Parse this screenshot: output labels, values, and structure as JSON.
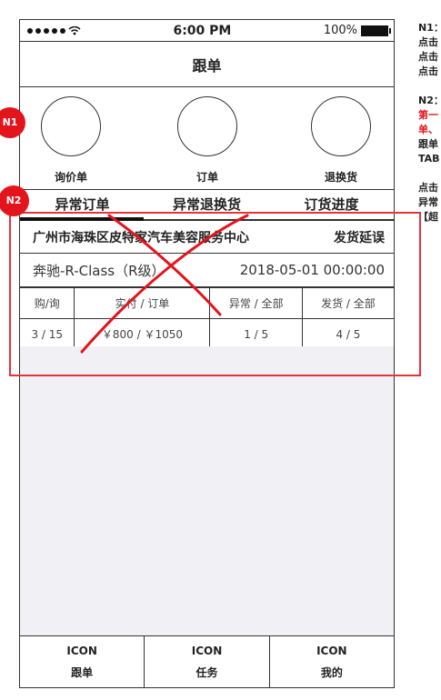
{
  "status_bar": {
    "time": "6:00 PM",
    "battery": "100%"
  },
  "nav": {
    "title": "跟单"
  },
  "quick_actions": [
    {
      "label": "询价单"
    },
    {
      "label": "订单"
    },
    {
      "label": "退换货"
    }
  ],
  "tabs": [
    {
      "label": "异常订单",
      "active": true
    },
    {
      "label": "异常退换货",
      "active": false
    },
    {
      "label": "订货进度",
      "active": false
    }
  ],
  "order": {
    "shop": "广州市海珠区皮特家汽车美容服务中心",
    "status": "发货延误",
    "car": "奔驰-R-Class（R级）",
    "datetime": "2018-05-01 00:00:00",
    "headers": [
      "购/询",
      "实付 / 订单",
      "异常 / 全部",
      "发货 / 全部"
    ],
    "values": [
      "3 / 15",
      "￥800 / ￥1050",
      "1 / 5",
      "4 / 5"
    ]
  },
  "bottom_nav": [
    {
      "icon": "ICON",
      "label": "跟单"
    },
    {
      "icon": "ICON",
      "label": "任务"
    },
    {
      "icon": "ICON",
      "label": "我的"
    }
  ],
  "annotations": {
    "n1_badge": "N1",
    "n2_badge": "N2",
    "notes": [
      "N1：",
      "点击",
      "点击",
      "点击",
      "",
      "N2：",
      "第一",
      "单、",
      "跟单",
      "TAB",
      "",
      "点击",
      "异常",
      "【超"
    ]
  },
  "colors": {
    "annotation_red": "#e3141c",
    "highlight_box": "#e5333a",
    "empty_bg": "#f1f1f5"
  }
}
